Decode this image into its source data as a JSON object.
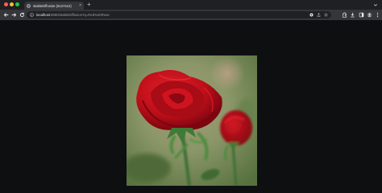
{
  "browser": {
    "tab": {
      "title": "stableDiffusion (512×512)",
      "favicon": "page-icon",
      "close_icon": "close-icon"
    },
    "new_tab_label": "+",
    "address_bar": {
      "host": "localhost",
      "path": ":8080/stableDiffusion?q=Red%20Rose"
    },
    "toolbar_icons": [
      "back-arrow-icon",
      "forward-arrow-icon",
      "reload-icon",
      "info-icon",
      "google-lens-icon",
      "share-icon",
      "bookmark-star-icon",
      "extensions-icon",
      "download-icon",
      "side-panel-icon",
      "profile-icon",
      "more-menu-icon"
    ]
  },
  "page": {
    "background": "#0e0f11",
    "image": {
      "subject": "Red rose",
      "alt": "Red Rose",
      "colors": {
        "petals": "#c8141e",
        "background": "#7b8f62",
        "stem": "#3c7a3a"
      }
    }
  },
  "colors": {
    "tab_strip": "#1f2023",
    "toolbar": "#35363a",
    "omnibox": "#202124",
    "close_dot": "#ff5f57",
    "minimize_dot": "#febc2e",
    "zoom_dot": "#28c840"
  }
}
